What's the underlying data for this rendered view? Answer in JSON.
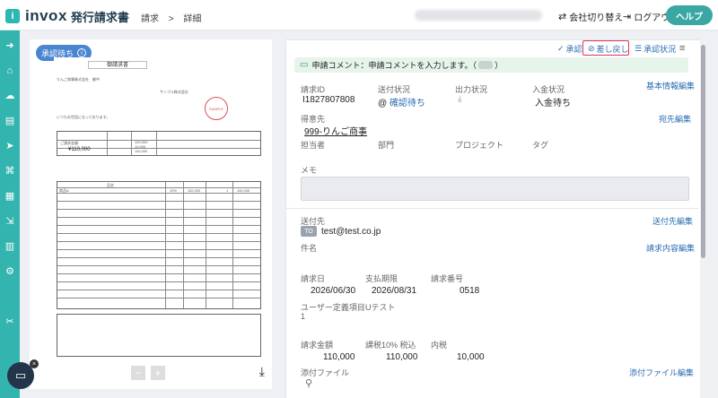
{
  "header": {
    "logo_mark": "i",
    "logo": "invox",
    "logo_sub": "発行請求書",
    "breadcrumbs": [
      "請求",
      ">",
      "詳細"
    ],
    "switch_company": "会社切り替え",
    "logout": "ログアウト",
    "help": "ヘルプ"
  },
  "preview": {
    "status_badge": "承認待ち",
    "doc_title": "御請求書",
    "recipient": "りんご商事株式会社　御中",
    "issuer": "サンプル株式会社",
    "thanks": "いつもお世話になっております。",
    "stamp": "SAMPLE",
    "amount_label": "ご請求金額",
    "amount": "¥110,000",
    "subtotal": "100,000",
    "tax": "10,000",
    "total": "110,000",
    "item_header": "品名",
    "item_name": "商品A",
    "item_tax": "10%",
    "item_unit": "110,000",
    "item_qty": "1",
    "item_amount": "110,000"
  },
  "toolbar": {
    "approve": "承認",
    "send_back": "差し戻し",
    "approval_status": "承認状況"
  },
  "comment": {
    "text": "申請コメント：申請コメントを入力します。（",
    "suffix": "）"
  },
  "basic": {
    "invoice_id_label": "請求ID",
    "invoice_id": "I1827807808",
    "send_status_label": "送付状況",
    "send_status": "確認待ち",
    "output_status_label": "出力状況",
    "payment_status_label": "入金状況",
    "payment_status": "入金待ち",
    "edit_basic": "基本情報編集",
    "customer_label": "得意先",
    "customer": "999-りんご商事",
    "edit_customer": "宛先編集",
    "person_label": "担当者",
    "dept_label": "部門",
    "project_label": "プロジェクト",
    "tag_label": "タグ",
    "memo_label": "メモ"
  },
  "sending": {
    "to_label": "送付先",
    "to_tag": "TO",
    "to_email": "test@test.co.jp",
    "edit_to": "送付先編集",
    "subject_label": "件名",
    "edit_content": "請求内容編集",
    "invoice_date_label": "請求日",
    "invoice_date": "2026/06/30",
    "due_date_label": "支払期限",
    "due_date": "2026/08/31",
    "invoice_no_label": "請求番号",
    "invoice_no": "0518",
    "custom_label": "ユーザー定義項目",
    "custom_index": "1",
    "custom_value": "Uテスト",
    "amount_label": "請求金額",
    "amount": "110,000",
    "tax10_label": "課税10% 税込",
    "tax10": "110,000",
    "inner_tax_label": "内税",
    "inner_tax": "10,000",
    "attach_label": "添付ファイル",
    "edit_attach": "添付ファイル編集"
  }
}
